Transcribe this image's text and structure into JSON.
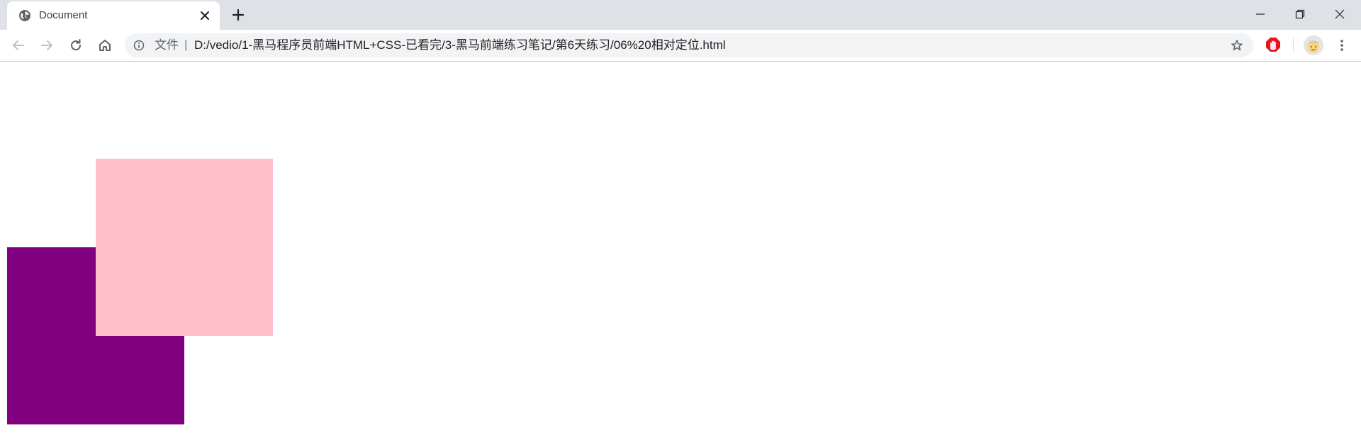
{
  "tab": {
    "title": "Document",
    "favicon_icon": "globe-icon",
    "close_icon": "close-icon"
  },
  "tabstrip": {
    "new_tab_icon": "plus-icon"
  },
  "window_controls": {
    "minimize_icon": "minimize-icon",
    "restore_icon": "restore-icon",
    "close_icon": "close-icon"
  },
  "toolbar": {
    "back_icon": "arrow-left-icon",
    "forward_icon": "arrow-right-icon",
    "reload_icon": "reload-icon",
    "home_icon": "home-icon",
    "menu_icon": "kebab-menu-icon",
    "extension_icon": "stop-hand-icon"
  },
  "omnibox": {
    "info_icon": "info-icon",
    "scheme_label": "文件",
    "separator": "|",
    "url": "D:/vedio/1-黑马程序员前端HTML+CSS-已看完/3-黑马前端练习笔记/第6天练习/06%20相对定位.html",
    "star_icon": "star-icon"
  },
  "page": {
    "background": "#ffffff",
    "boxes": [
      {
        "name": "purple-box",
        "color": "#800080"
      },
      {
        "name": "pink-box",
        "color": "#ffc0cb"
      }
    ]
  },
  "colors": {
    "tabstrip_bg": "#dee1e6",
    "omnibox_bg": "#f1f3f4",
    "icon_gray": "#5f6368",
    "extension_red": "#e8131c"
  }
}
